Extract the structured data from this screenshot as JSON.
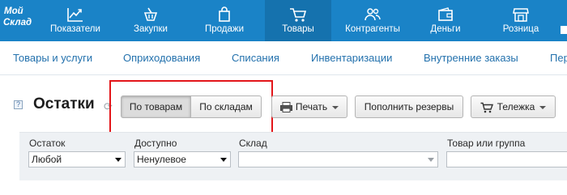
{
  "colors": {
    "nav_bg": "#1a83c7",
    "nav_active": "#1572ae",
    "link": "#2371ad",
    "highlight": "#e3161a"
  },
  "logo": {
    "line1": "Мой",
    "line2": "Склад"
  },
  "topnav": [
    {
      "label": "Показатели",
      "icon": "chart-icon"
    },
    {
      "label": "Закупки",
      "icon": "basket-icon"
    },
    {
      "label": "Продажи",
      "icon": "shopping-bag-icon"
    },
    {
      "label": "Товары",
      "icon": "cart-icon",
      "active": true
    },
    {
      "label": "Контрагенты",
      "icon": "users-icon"
    },
    {
      "label": "Деньги",
      "icon": "wallet-icon"
    },
    {
      "label": "Розница",
      "icon": "store-icon"
    }
  ],
  "subnav": [
    "Товары и услуги",
    "Оприходования",
    "Списания",
    "Инвентаризации",
    "Внутренние заказы",
    "Пере"
  ],
  "page": {
    "help": "?",
    "title": "Остатки"
  },
  "toolbar": {
    "by_products": "По товарам",
    "by_warehouses": "По складам",
    "print": "Печать",
    "replenish": "Пополнить резервы",
    "cart": "Тележка"
  },
  "filters": {
    "balance": {
      "label": "Остаток",
      "value": "Любой"
    },
    "available": {
      "label": "Доступно",
      "value": "Ненулевое"
    },
    "warehouse": {
      "label": "Склад",
      "value": ""
    },
    "product": {
      "label": "Товар или группа",
      "value": ""
    }
  }
}
